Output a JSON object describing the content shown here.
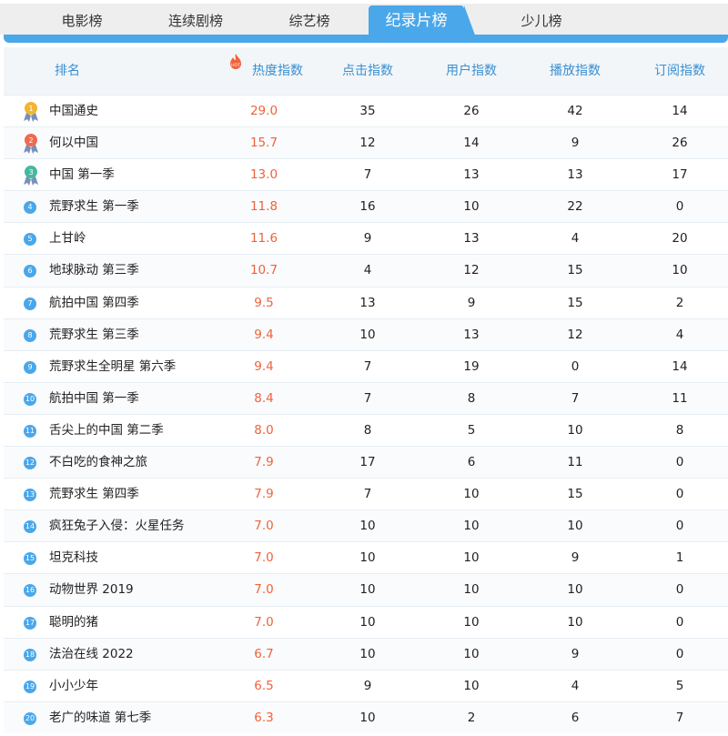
{
  "tabs": [
    {
      "label": "电影榜",
      "active": false
    },
    {
      "label": "连续剧榜",
      "active": false
    },
    {
      "label": "综艺榜",
      "active": false
    },
    {
      "label": "纪录片榜",
      "active": true
    },
    {
      "label": "少儿榜",
      "active": false
    }
  ],
  "header": {
    "rank": "排名",
    "hot": "热度指数",
    "hot_badge": "HOT",
    "clicks": "点击指数",
    "users": "用户指数",
    "plays": "播放指数",
    "subs": "订阅指数"
  },
  "colors": {
    "accent": "#4aa7ea",
    "hot": "#f0623a",
    "gold": "#f2b530",
    "silver_red": "#ef6a4f",
    "bronze_teal": "#45b9a0"
  },
  "rows": [
    {
      "rank": "1",
      "name": "中国通史",
      "hot": "29.0",
      "clicks": "35",
      "users": "26",
      "plays": "42",
      "subs": "14"
    },
    {
      "rank": "2",
      "name": "何以中国",
      "hot": "15.7",
      "clicks": "12",
      "users": "14",
      "plays": "9",
      "subs": "26"
    },
    {
      "rank": "3",
      "name": "中国 第一季",
      "hot": "13.0",
      "clicks": "7",
      "users": "13",
      "plays": "13",
      "subs": "17"
    },
    {
      "rank": "4",
      "name": "荒野求生 第一季",
      "hot": "11.8",
      "clicks": "16",
      "users": "10",
      "plays": "22",
      "subs": "0"
    },
    {
      "rank": "5",
      "name": "上甘岭",
      "hot": "11.6",
      "clicks": "9",
      "users": "13",
      "plays": "4",
      "subs": "20"
    },
    {
      "rank": "6",
      "name": "地球脉动 第三季",
      "hot": "10.7",
      "clicks": "4",
      "users": "12",
      "plays": "15",
      "subs": "10"
    },
    {
      "rank": "7",
      "name": "航拍中国 第四季",
      "hot": "9.5",
      "clicks": "13",
      "users": "9",
      "plays": "15",
      "subs": "2"
    },
    {
      "rank": "8",
      "name": "荒野求生 第三季",
      "hot": "9.4",
      "clicks": "10",
      "users": "13",
      "plays": "12",
      "subs": "4"
    },
    {
      "rank": "9",
      "name": "荒野求生全明星 第六季",
      "hot": "9.4",
      "clicks": "7",
      "users": "19",
      "plays": "0",
      "subs": "14"
    },
    {
      "rank": "10",
      "name": "航拍中国 第一季",
      "hot": "8.4",
      "clicks": "7",
      "users": "8",
      "plays": "7",
      "subs": "11"
    },
    {
      "rank": "11",
      "name": "舌尖上的中国 第二季",
      "hot": "8.0",
      "clicks": "8",
      "users": "5",
      "plays": "10",
      "subs": "8"
    },
    {
      "rank": "12",
      "name": "不白吃的食神之旅",
      "hot": "7.9",
      "clicks": "17",
      "users": "6",
      "plays": "11",
      "subs": "0"
    },
    {
      "rank": "13",
      "name": "荒野求生 第四季",
      "hot": "7.9",
      "clicks": "7",
      "users": "10",
      "plays": "15",
      "subs": "0"
    },
    {
      "rank": "14",
      "name": "疯狂兔子入侵：火星任务",
      "hot": "7.0",
      "clicks": "10",
      "users": "10",
      "plays": "10",
      "subs": "0"
    },
    {
      "rank": "15",
      "name": "坦克科技",
      "hot": "7.0",
      "clicks": "10",
      "users": "10",
      "plays": "9",
      "subs": "1"
    },
    {
      "rank": "16",
      "name": "动物世界 2019",
      "hot": "7.0",
      "clicks": "10",
      "users": "10",
      "plays": "10",
      "subs": "0"
    },
    {
      "rank": "17",
      "name": "聪明的猪",
      "hot": "7.0",
      "clicks": "10",
      "users": "10",
      "plays": "10",
      "subs": "0"
    },
    {
      "rank": "18",
      "name": "法治在线 2022",
      "hot": "6.7",
      "clicks": "10",
      "users": "10",
      "plays": "9",
      "subs": "0"
    },
    {
      "rank": "19",
      "name": "小小少年",
      "hot": "6.5",
      "clicks": "9",
      "users": "10",
      "plays": "4",
      "subs": "5"
    },
    {
      "rank": "20",
      "name": "老广的味道 第七季",
      "hot": "6.3",
      "clicks": "10",
      "users": "2",
      "plays": "6",
      "subs": "7"
    }
  ]
}
